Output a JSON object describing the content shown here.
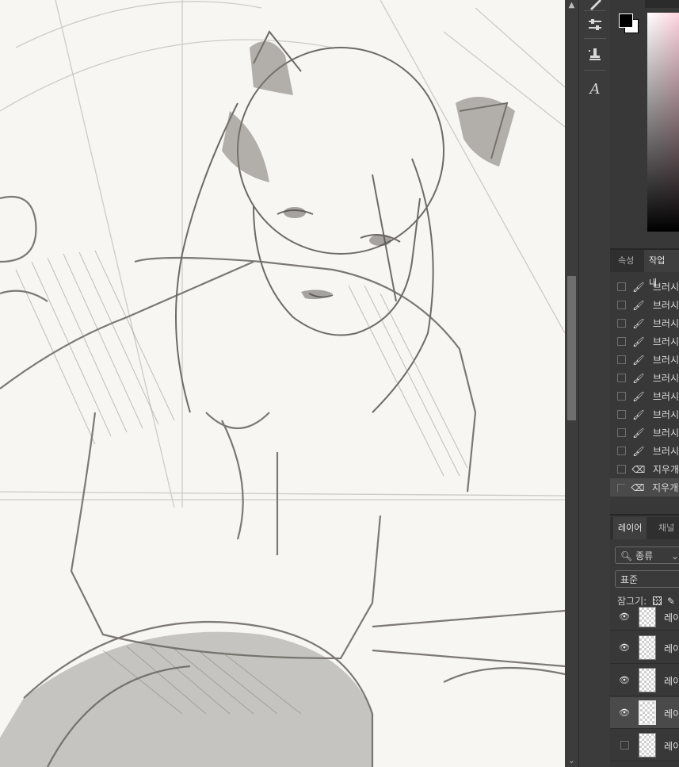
{
  "app": "Photoshop",
  "tools": {
    "items": [
      {
        "name": "brush-tool-icon"
      },
      {
        "name": "adjustment-sliders-icon"
      },
      {
        "name": "clone-stamp-icon"
      },
      {
        "name": "type-tool-icon",
        "glyph": "A"
      }
    ]
  },
  "colors": {
    "foreground": "#000000",
    "background": "#ffffff",
    "accent_picker_hue": "#ffd4e0",
    "panel_bg": "#383838"
  },
  "history_panel": {
    "tabs": [
      {
        "label": "속성"
      },
      {
        "label": "작업 내"
      }
    ],
    "items": [
      {
        "icon": "brush-icon",
        "label": "브러시"
      },
      {
        "icon": "brush-icon",
        "label": "브러시"
      },
      {
        "icon": "brush-icon",
        "label": "브러시"
      },
      {
        "icon": "brush-icon",
        "label": "브러시"
      },
      {
        "icon": "brush-icon",
        "label": "브러시"
      },
      {
        "icon": "brush-icon",
        "label": "브러시"
      },
      {
        "icon": "brush-icon",
        "label": "브러시"
      },
      {
        "icon": "brush-icon",
        "label": "브러시"
      },
      {
        "icon": "brush-icon",
        "label": "브러시"
      },
      {
        "icon": "brush-icon",
        "label": "브러시"
      },
      {
        "icon": "eraser-icon",
        "label": "지우개"
      },
      {
        "icon": "eraser-icon",
        "label": "지우개"
      }
    ],
    "selected_index": 11
  },
  "layers_panel": {
    "tabs": [
      {
        "label": "레이어"
      },
      {
        "label": "채널"
      }
    ],
    "filter": {
      "label": "종류"
    },
    "blend_mode": "표준",
    "lock_label": "잠그기:",
    "layers": [
      {
        "name": "레이어",
        "visible": true
      },
      {
        "name": "레이어",
        "visible": true
      },
      {
        "name": "레이어",
        "visible": true
      },
      {
        "name": "레이어",
        "visible": true,
        "selected": true
      },
      {
        "name": "레이어",
        "visible": false
      }
    ]
  }
}
